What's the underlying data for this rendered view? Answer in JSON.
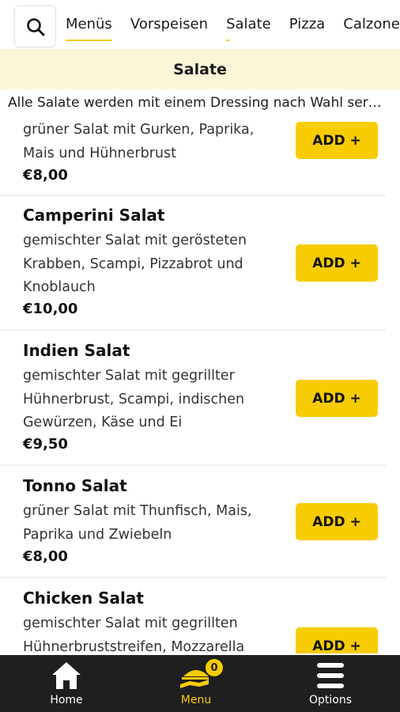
{
  "topbar": {
    "tabs": [
      "Menüs",
      "Vorspeisen",
      "Salate",
      "Pizza",
      "Calzone"
    ],
    "active_tab": "Menüs"
  },
  "section": {
    "title": "Salate",
    "description": "Alle Salate werden mit einem Dressing nach Wahl serviert"
  },
  "items": [
    {
      "name": "",
      "desc_lines": [
        "grüner Salat mit Gurken, Paprika,",
        "Mais und Hühnerbrust"
      ],
      "price": "€8,00",
      "button": "ADD +"
    },
    {
      "name": "Camperini Salat",
      "desc_lines": [
        "gemischter Salat mit gerösteten",
        "Krabben, Scampi, Pizzabrot und",
        "Knoblauch"
      ],
      "price": "€10,00",
      "button": "ADD +"
    },
    {
      "name": "Indien Salat",
      "desc_lines": [
        "gemischter Salat mit gegrillter",
        "Hühnerbrust, Scampi, indischen",
        "Gewürzen, Käse und Ei"
      ],
      "price": "€9,50",
      "button": "ADD +"
    },
    {
      "name": "Tonno Salat",
      "desc_lines": [
        "grüner Salat mit Thunfisch, Mais,",
        "Paprika und Zwiebeln"
      ],
      "price": "€8,00",
      "button": "ADD +"
    },
    {
      "name": "Chicken Salat",
      "desc_lines": [
        "gemischter Salat mit gegrillten",
        "Hühnerbruststreifen, Mozzarella"
      ],
      "price": "",
      "button": "ADD +"
    }
  ],
  "bottom_nav": {
    "home": "Home",
    "menu": "Menu",
    "options": "Options",
    "cart_count": "0"
  },
  "colors": {
    "accent": "#f7cc00",
    "header_bg": "#fcf6d8",
    "nav_bg": "#1f1f1f"
  }
}
